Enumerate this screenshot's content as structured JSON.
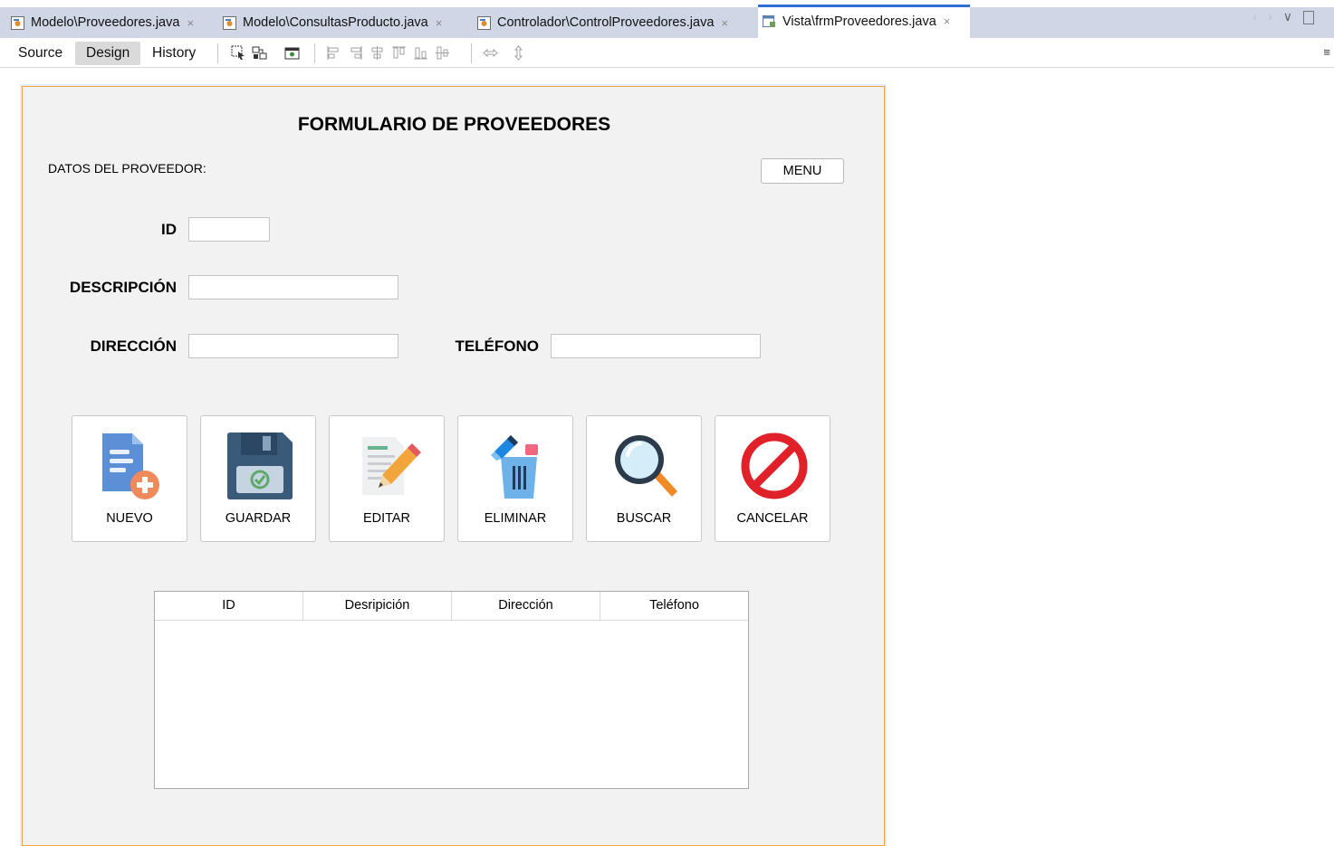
{
  "tabs": [
    {
      "label": "Modelo\\Proveedores.java",
      "close": "×",
      "icon": "java-class-icon",
      "active": false
    },
    {
      "label": "Modelo\\ConsultasProducto.java",
      "close": "×",
      "icon": "java-class-icon",
      "active": false
    },
    {
      "label": "Controlador\\ControlProveedores.java",
      "close": "×",
      "icon": "java-class-icon",
      "active": false
    },
    {
      "label": "Vista\\frmProveedores.java",
      "close": "×",
      "icon": "jframe-form-icon",
      "active": true
    }
  ],
  "toolbar": {
    "source": "Source",
    "design": "Design",
    "history": "History",
    "selected_view": "Design"
  },
  "form": {
    "title": "FORMULARIO DE PROVEEDORES",
    "section_label": "DATOS DEL PROVEEDOR:",
    "menu_button": "MENU",
    "fields": {
      "id_label": "ID",
      "id_value": "",
      "descripcion_label": "DESCRIPCIÓN",
      "descripcion_value": "",
      "direccion_label": "DIRECCIÓN",
      "direccion_value": "",
      "telefono_label": "TELÉFONO",
      "telefono_value": ""
    },
    "buttons": [
      {
        "label": "NUEVO",
        "icon": "new-document-icon"
      },
      {
        "label": "GUARDAR",
        "icon": "floppy-disk-icon"
      },
      {
        "label": "EDITAR",
        "icon": "edit-pencil-icon"
      },
      {
        "label": "ELIMINAR",
        "icon": "trash-bin-icon"
      },
      {
        "label": "BUSCAR",
        "icon": "magnifier-icon"
      },
      {
        "label": "CANCELAR",
        "icon": "cancel-icon"
      }
    ],
    "table": {
      "columns": [
        "ID",
        "Desripición",
        "Dirección",
        "Teléfono"
      ],
      "rows": []
    }
  },
  "colors": {
    "form_border": "#f0a443",
    "active_tab_accent": "#2f6fd6",
    "tab_strip": "#cfd6e5",
    "form_background": "#f2f2f2",
    "cancel_red": "#e0212a",
    "save_blue": "#3a5a7a",
    "search_orange": "#f08a24"
  }
}
